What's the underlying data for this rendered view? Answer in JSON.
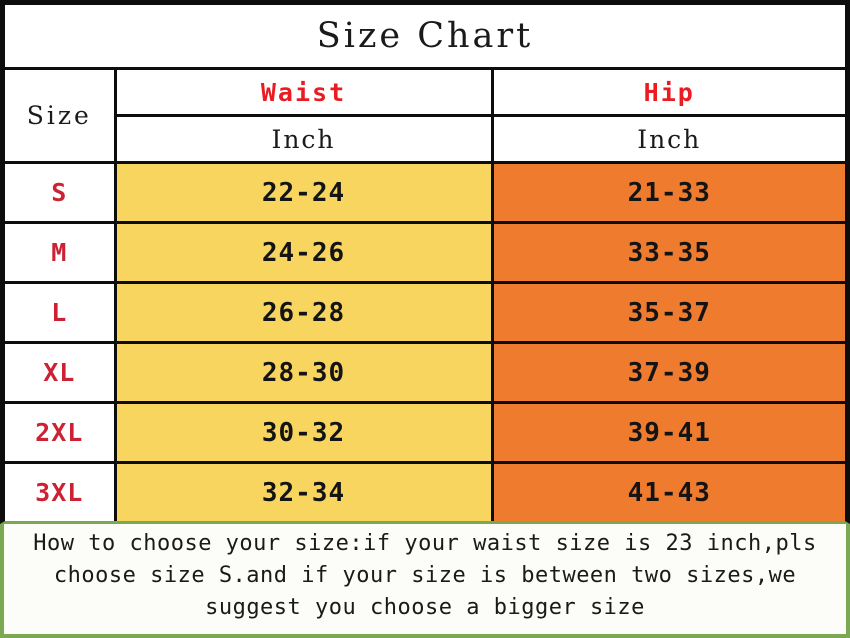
{
  "title": "Size Chart",
  "table": {
    "size_header": "Size",
    "measure_headers": [
      {
        "label": "Waist",
        "unit": "Inch"
      },
      {
        "label": "Hip",
        "unit": "Inch"
      }
    ],
    "rows": [
      {
        "size": "S",
        "waist": "22-24",
        "hip": "21-33"
      },
      {
        "size": "M",
        "waist": "24-26",
        "hip": "33-35"
      },
      {
        "size": "L",
        "waist": "26-28",
        "hip": "35-37"
      },
      {
        "size": "XL",
        "waist": "28-30",
        "hip": "37-39"
      },
      {
        "size": "2XL",
        "waist": "30-32",
        "hip": "39-41"
      },
      {
        "size": "3XL",
        "waist": "32-34",
        "hip": "41-43"
      }
    ]
  },
  "note": "How to choose your size:if your waist size is 23 inch,pls choose size S.and if your size is between two sizes,we suggest you choose a bigger size",
  "colors": {
    "title_text": "#1a1a1a",
    "header_red": "#ea1c22",
    "size_red": "#cc2233",
    "waist_fill": "#f8d55e",
    "hip_fill": "#ef7b2e",
    "grid_line": "#0d0d0d",
    "note_border_green": "#7ba852",
    "note_background": "#fcfcf8"
  }
}
